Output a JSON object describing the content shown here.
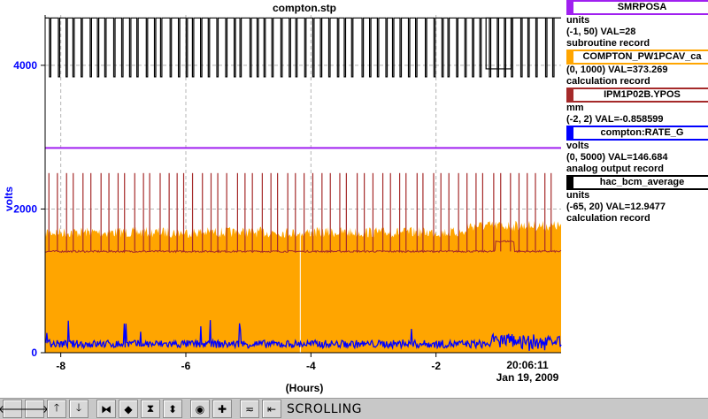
{
  "chart_data": {
    "type": "line",
    "title": "compton.stp",
    "xlabel": "(Hours)",
    "ylabel": "volts",
    "xlim": [
      -8.25,
      0
    ],
    "ylim": [
      0,
      4700
    ],
    "x_ticks": [
      "-8",
      "-6",
      "-4",
      "-2"
    ],
    "y_ticks": [
      "0",
      "2000",
      "4000"
    ],
    "time_label": "20:06:11",
    "date_label": "Jan 19, 2009",
    "series": [
      {
        "name": "SMRPOSA",
        "color": "#a020f0",
        "values": [
          2850
        ]
      },
      {
        "name": "COMPTON_PW1PCAV_ca",
        "color": "#ffa500",
        "values": [
          1750,
          0
        ]
      },
      {
        "name": "IPM1P02B.YPOS",
        "color": "#a52a2a",
        "values": [
          1410,
          2500
        ]
      },
      {
        "name": "compton:RATE_G",
        "color": "#0000ff",
        "values": [
          120
        ]
      },
      {
        "name": "hac_bcm_average",
        "color": "#000000",
        "values": [
          4660,
          3840
        ]
      }
    ]
  },
  "legend": [
    {
      "pv": "SMRPOSA",
      "color": "#a020f0",
      "units": "units",
      "range": "(-1, 50) VAL=28",
      "type": "subroutine record"
    },
    {
      "pv": "COMPTON_PW1PCAV_ca",
      "color": "#ffa500",
      "units": "",
      "range": "(0, 1000) VAL=373.269",
      "type": "calculation record"
    },
    {
      "pv": "IPM1P02B.YPOS",
      "color": "#a52a2a",
      "units": "mm",
      "range": "(-2, 2) VAL=-0.858599",
      "type": ""
    },
    {
      "pv": "compton:RATE_G",
      "color": "#0000ff",
      "units": "volts",
      "range": "(0, 5000) VAL=146.684",
      "type": "analog output record"
    },
    {
      "pv": "hac_bcm_average",
      "color": "#000000",
      "units": "units",
      "range": "(-65, 20) VAL=12.9477",
      "type": "calculation record"
    }
  ],
  "toolbar": {
    "status_label": "SCROLLING",
    "buttons": [
      {
        "name": "pan-left-button",
        "glyph": "🡐"
      },
      {
        "name": "pan-right-button",
        "glyph": "🡒"
      },
      {
        "name": "pan-up-button",
        "glyph": "🡑"
      },
      {
        "name": "pan-down-button",
        "glyph": "🡓"
      },
      {
        "name": "zoom-in-x-button",
        "glyph": "⧓"
      },
      {
        "name": "zoom-out-x-button",
        "glyph": "◆"
      },
      {
        "name": "zoom-in-y-button",
        "glyph": "⧗"
      },
      {
        "name": "zoom-out-y-button",
        "glyph": "⬍"
      },
      {
        "name": "zoom-pan-button",
        "glyph": "◉"
      },
      {
        "name": "crosshair-button",
        "glyph": "✚"
      },
      {
        "name": "scroll-mode-button",
        "glyph": "≂"
      },
      {
        "name": "undo-button",
        "glyph": "⇤"
      }
    ]
  }
}
